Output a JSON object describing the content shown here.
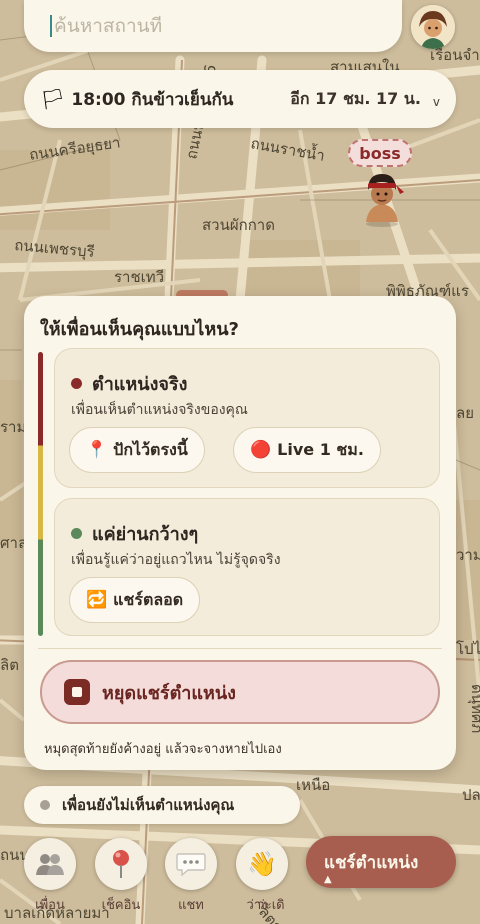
{
  "map": {
    "labels": {
      "top_right": "สามเสนใน",
      "prison": "เรือนจำ",
      "road_1": "ถนนครีอยุธยา",
      "road_2": "ถนนพระราม 6",
      "road_3": "ถนนราชน้ำ",
      "district": "สวนผักกาด",
      "road_4": "ถนนเพชรบุรี",
      "place": "ราชเทวี",
      "right_place": "พิพิธภัณฑ์แร",
      "left_edge_1": "ราม",
      "left_edge_2": "ศาล",
      "left_edge_3": "ลิต",
      "right_edge_1": "ลย",
      "right_edge_2": "วาม",
      "right_edge_3": "โปไ",
      "right_edge_4": "ดนุทศภ",
      "right_edge_5": "ปล",
      "north": "เหนือ",
      "bottom": "ลตร",
      "bottom_left": "ถนน",
      "bottom_left_2": "ข่าย",
      "bottom_label": "บาลเกิดหลายมา"
    }
  },
  "search": {
    "placeholder": "ค้นหาสถานที"
  },
  "user": {
    "avatar_icon": "user-avatar"
  },
  "event": {
    "flag_icon": "🏳",
    "title": "18:00 กินข้าวเย็นกัน",
    "countdown": "อีก 17 ชม. 17 น.",
    "chevron": "v"
  },
  "boss": {
    "label": "boss"
  },
  "panel": {
    "title": "ให้เพื่อนเห็นคุณแบบไหน?",
    "exact": {
      "title": "ตำแหน่งจริง",
      "desc": "เพื่อนเห็นตำแหน่งจริงของคุณ",
      "dot_color": "#8b2a2a",
      "pin_label": "ปักไว้ตรงนี้",
      "pin_icon": "📍",
      "live_label": "Live 1 ชม.",
      "live_icon": "🔴"
    },
    "area": {
      "title": "แค่ย่านกว้างๆ",
      "desc": "เพื่อนรู้แค่ว่าอยู่แถวไหน ไม่รู้จุดจริง",
      "dot_color": "#5a8a5a",
      "always_label": "แชร์ตลอด",
      "always_icon": "🔁"
    },
    "stop_label": "หยุดแชร์ตำแหน่ง",
    "footnote": "หมุดสุดท้ายยังค้างอยู่ แล้วจะจางหายไปเอง"
  },
  "status": {
    "text": "เพื่อนยังไม่เห็นตำแหน่งคุณ"
  },
  "nav": {
    "friends_label": "เพื่อน",
    "checkin_label": "เช็คอิน",
    "chat_label": "แชท",
    "free_label": "ว่าง",
    "wave_label": "ว่ะเดิ",
    "share_label": "แชร์ตำแหน่ง",
    "share_caret": "▲"
  },
  "colors": {
    "accent": "#a85e4e",
    "panel_bg": "#fbf6ea",
    "danger": "#8b2a2a"
  }
}
